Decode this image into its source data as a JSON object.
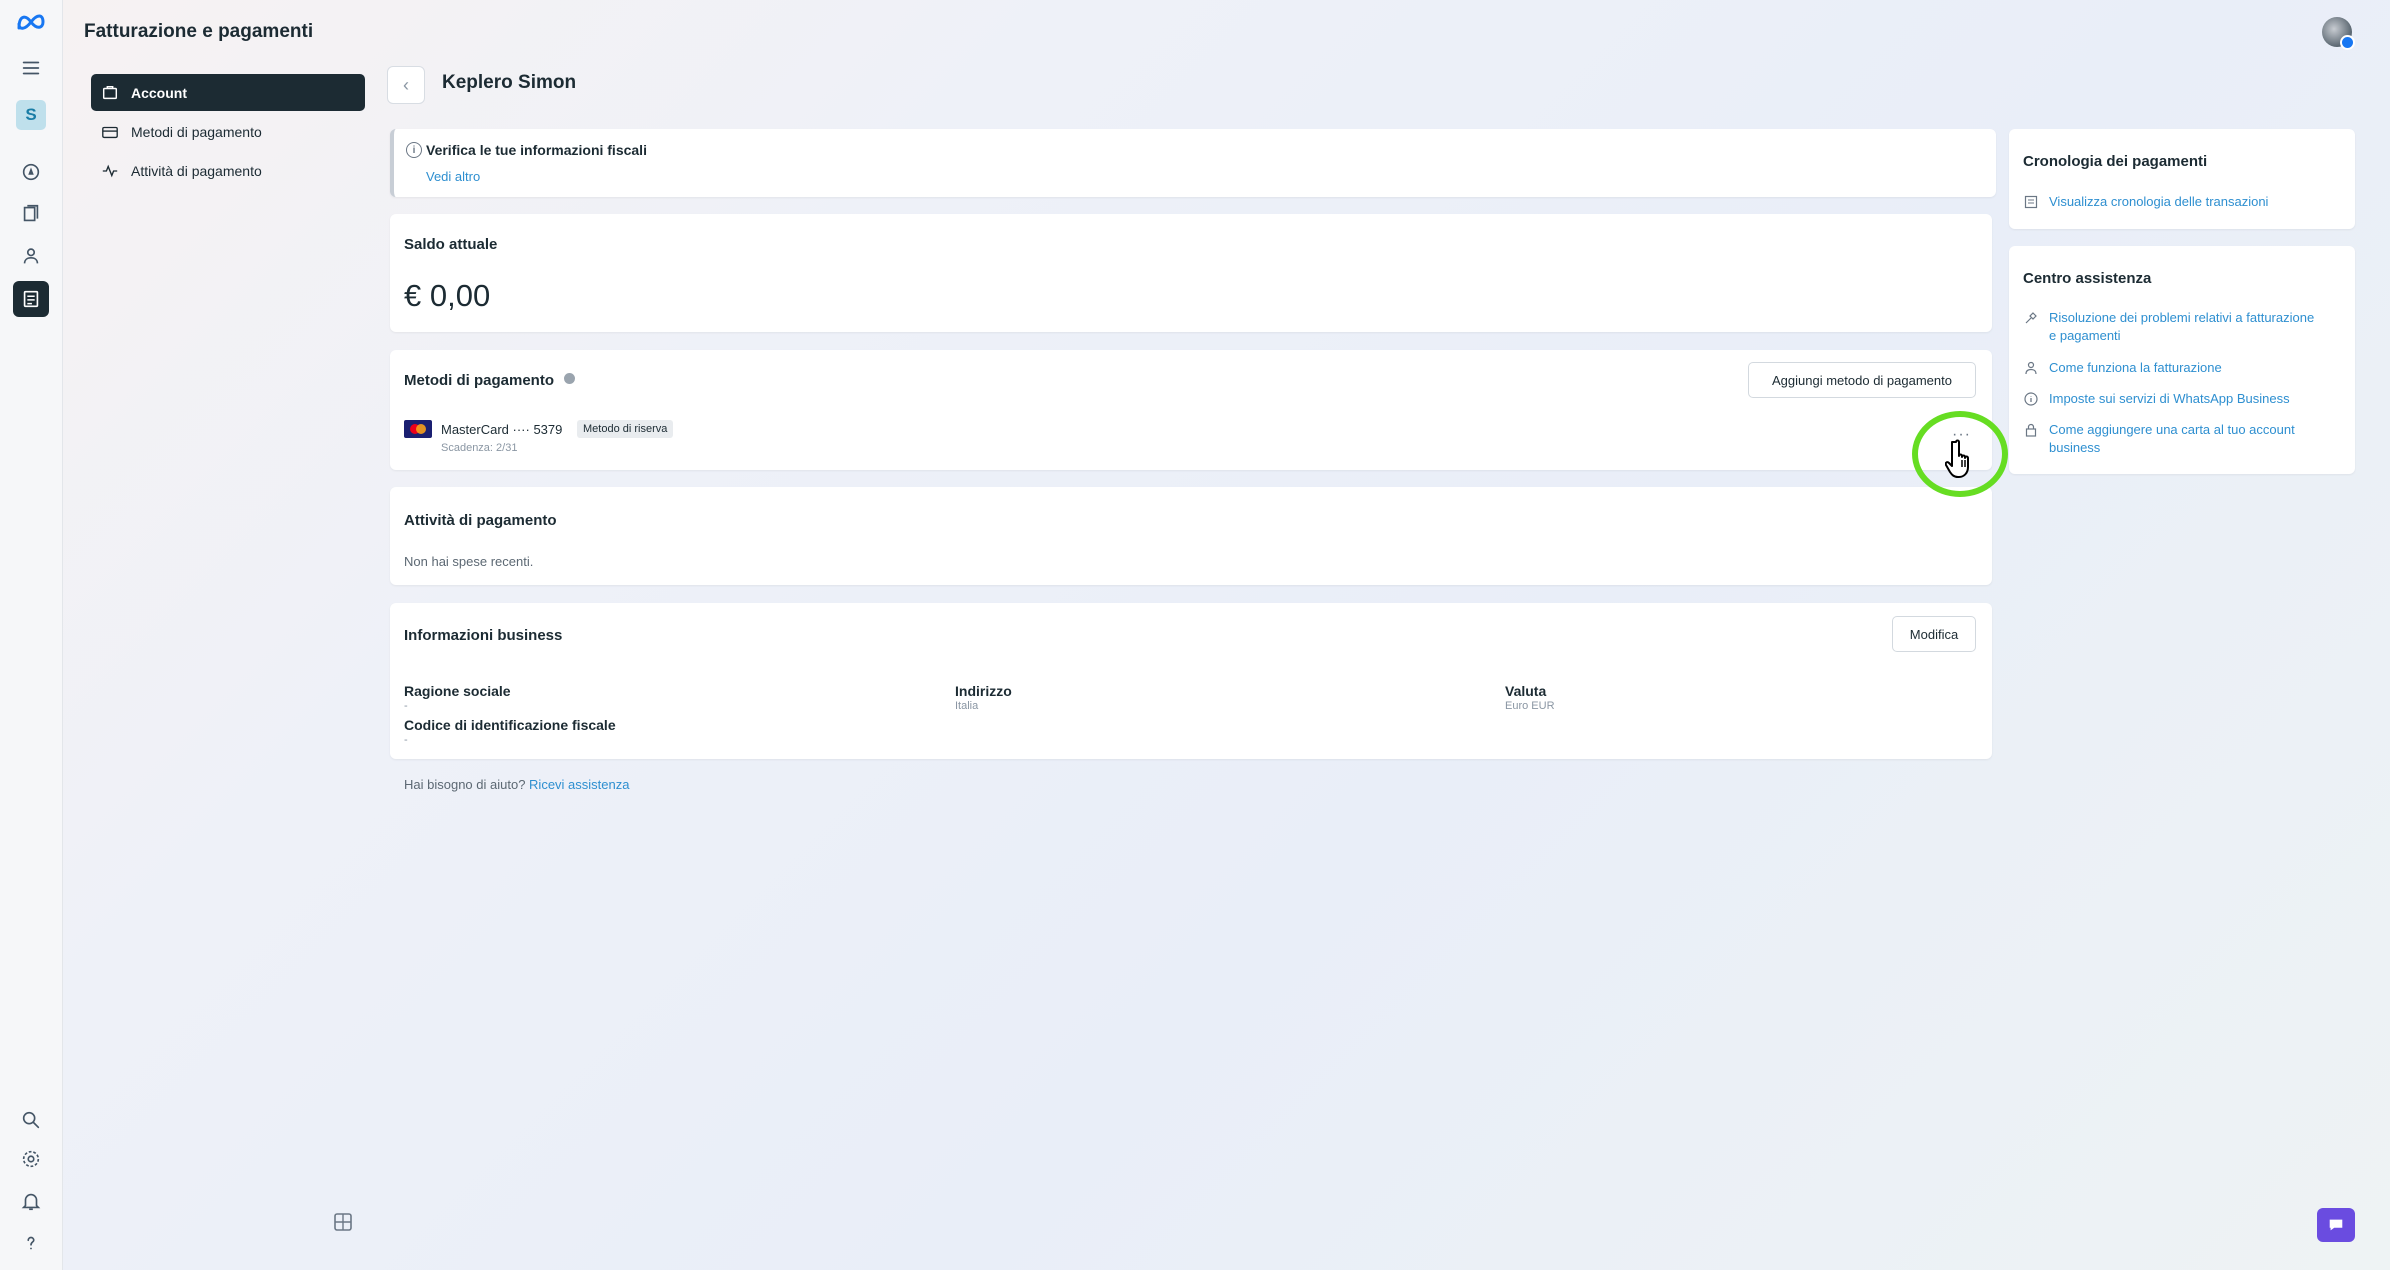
{
  "header": {
    "title": "Fatturazione e pagamenti"
  },
  "rail": {
    "badge_letter": "S"
  },
  "sidenav": {
    "items": [
      {
        "label": "Account"
      },
      {
        "label": "Metodi di pagamento"
      },
      {
        "label": "Attività di pagamento"
      }
    ]
  },
  "account": {
    "name": "Keplero Simon"
  },
  "verify": {
    "title": "Verifica le tue informazioni fiscali",
    "link": "Vedi altro"
  },
  "balance": {
    "title": "Saldo attuale",
    "value": "€ 0,00"
  },
  "payment_methods": {
    "title": "Metodi di pagamento",
    "add_button": "Aggiungi metodo di pagamento",
    "card": {
      "name": "MasterCard ···· 5379",
      "tag": "Metodo di riserva",
      "expiry": "Scadenza: 2/31"
    },
    "more_label": "···"
  },
  "activity": {
    "title": "Attività di pagamento",
    "empty": "Non hai spese recenti."
  },
  "business": {
    "title": "Informazioni business",
    "edit_button": "Modifica",
    "fields": [
      {
        "label": "Ragione sociale",
        "value": "-"
      },
      {
        "label": "Indirizzo",
        "value": "Italia"
      },
      {
        "label": "Valuta",
        "value": "Euro EUR"
      },
      {
        "label": "Codice di identificazione fiscale",
        "value": "-"
      }
    ]
  },
  "help": {
    "text": "Hai bisogno di aiuto?",
    "link": "Ricevi assistenza"
  },
  "history": {
    "title": "Cronologia dei pagamenti",
    "link": "Visualizza cronologia delle transazioni"
  },
  "help_center": {
    "title": "Centro assistenza",
    "links": [
      "Risoluzione dei problemi relativi a fatturazione e pagamenti",
      "Come funziona la fatturazione",
      "Imposte sui servizi di WhatsApp Business",
      "Come aggiungere una carta al tuo account business"
    ]
  },
  "colors": {
    "accent_link": "#2e8fd0",
    "nav_active": "#1c2b33",
    "cursor_ring": "#66dd22",
    "chat_fab": "#6a4ce0"
  }
}
